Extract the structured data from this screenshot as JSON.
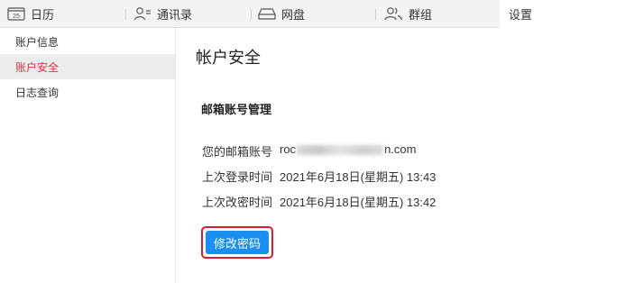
{
  "tabs": [
    {
      "label": "日历",
      "icon": "calendar-icon",
      "icon_text": "25"
    },
    {
      "label": "通讯录",
      "icon": "contacts-icon"
    },
    {
      "label": "网盘",
      "icon": "cloud-drive-icon"
    },
    {
      "label": "群组",
      "icon": "group-icon"
    },
    {
      "label": "设置",
      "icon": ""
    }
  ],
  "active_tab": "设置",
  "sidebar": {
    "items": [
      {
        "label": "账户信息"
      },
      {
        "label": "账户安全"
      },
      {
        "label": "日志查询"
      }
    ],
    "active_item": "账户安全"
  },
  "main": {
    "title": "帐户安全",
    "section_title": "邮箱账号管理",
    "email_label": "您的邮箱账号",
    "email_prefix": "roc",
    "email_suffix": "n.com",
    "last_login_label": "上次登录时间",
    "last_login_value": "2021年6月18日(星期五) 13:43",
    "last_change_label": "上次改密时间",
    "last_change_value": "2021年6月18日(星期五) 13:42",
    "change_password_button": "修改密码"
  },
  "colors": {
    "accent_red": "#d9363e",
    "button_blue": "#1a8ff0",
    "highlight_border": "#d62030"
  }
}
